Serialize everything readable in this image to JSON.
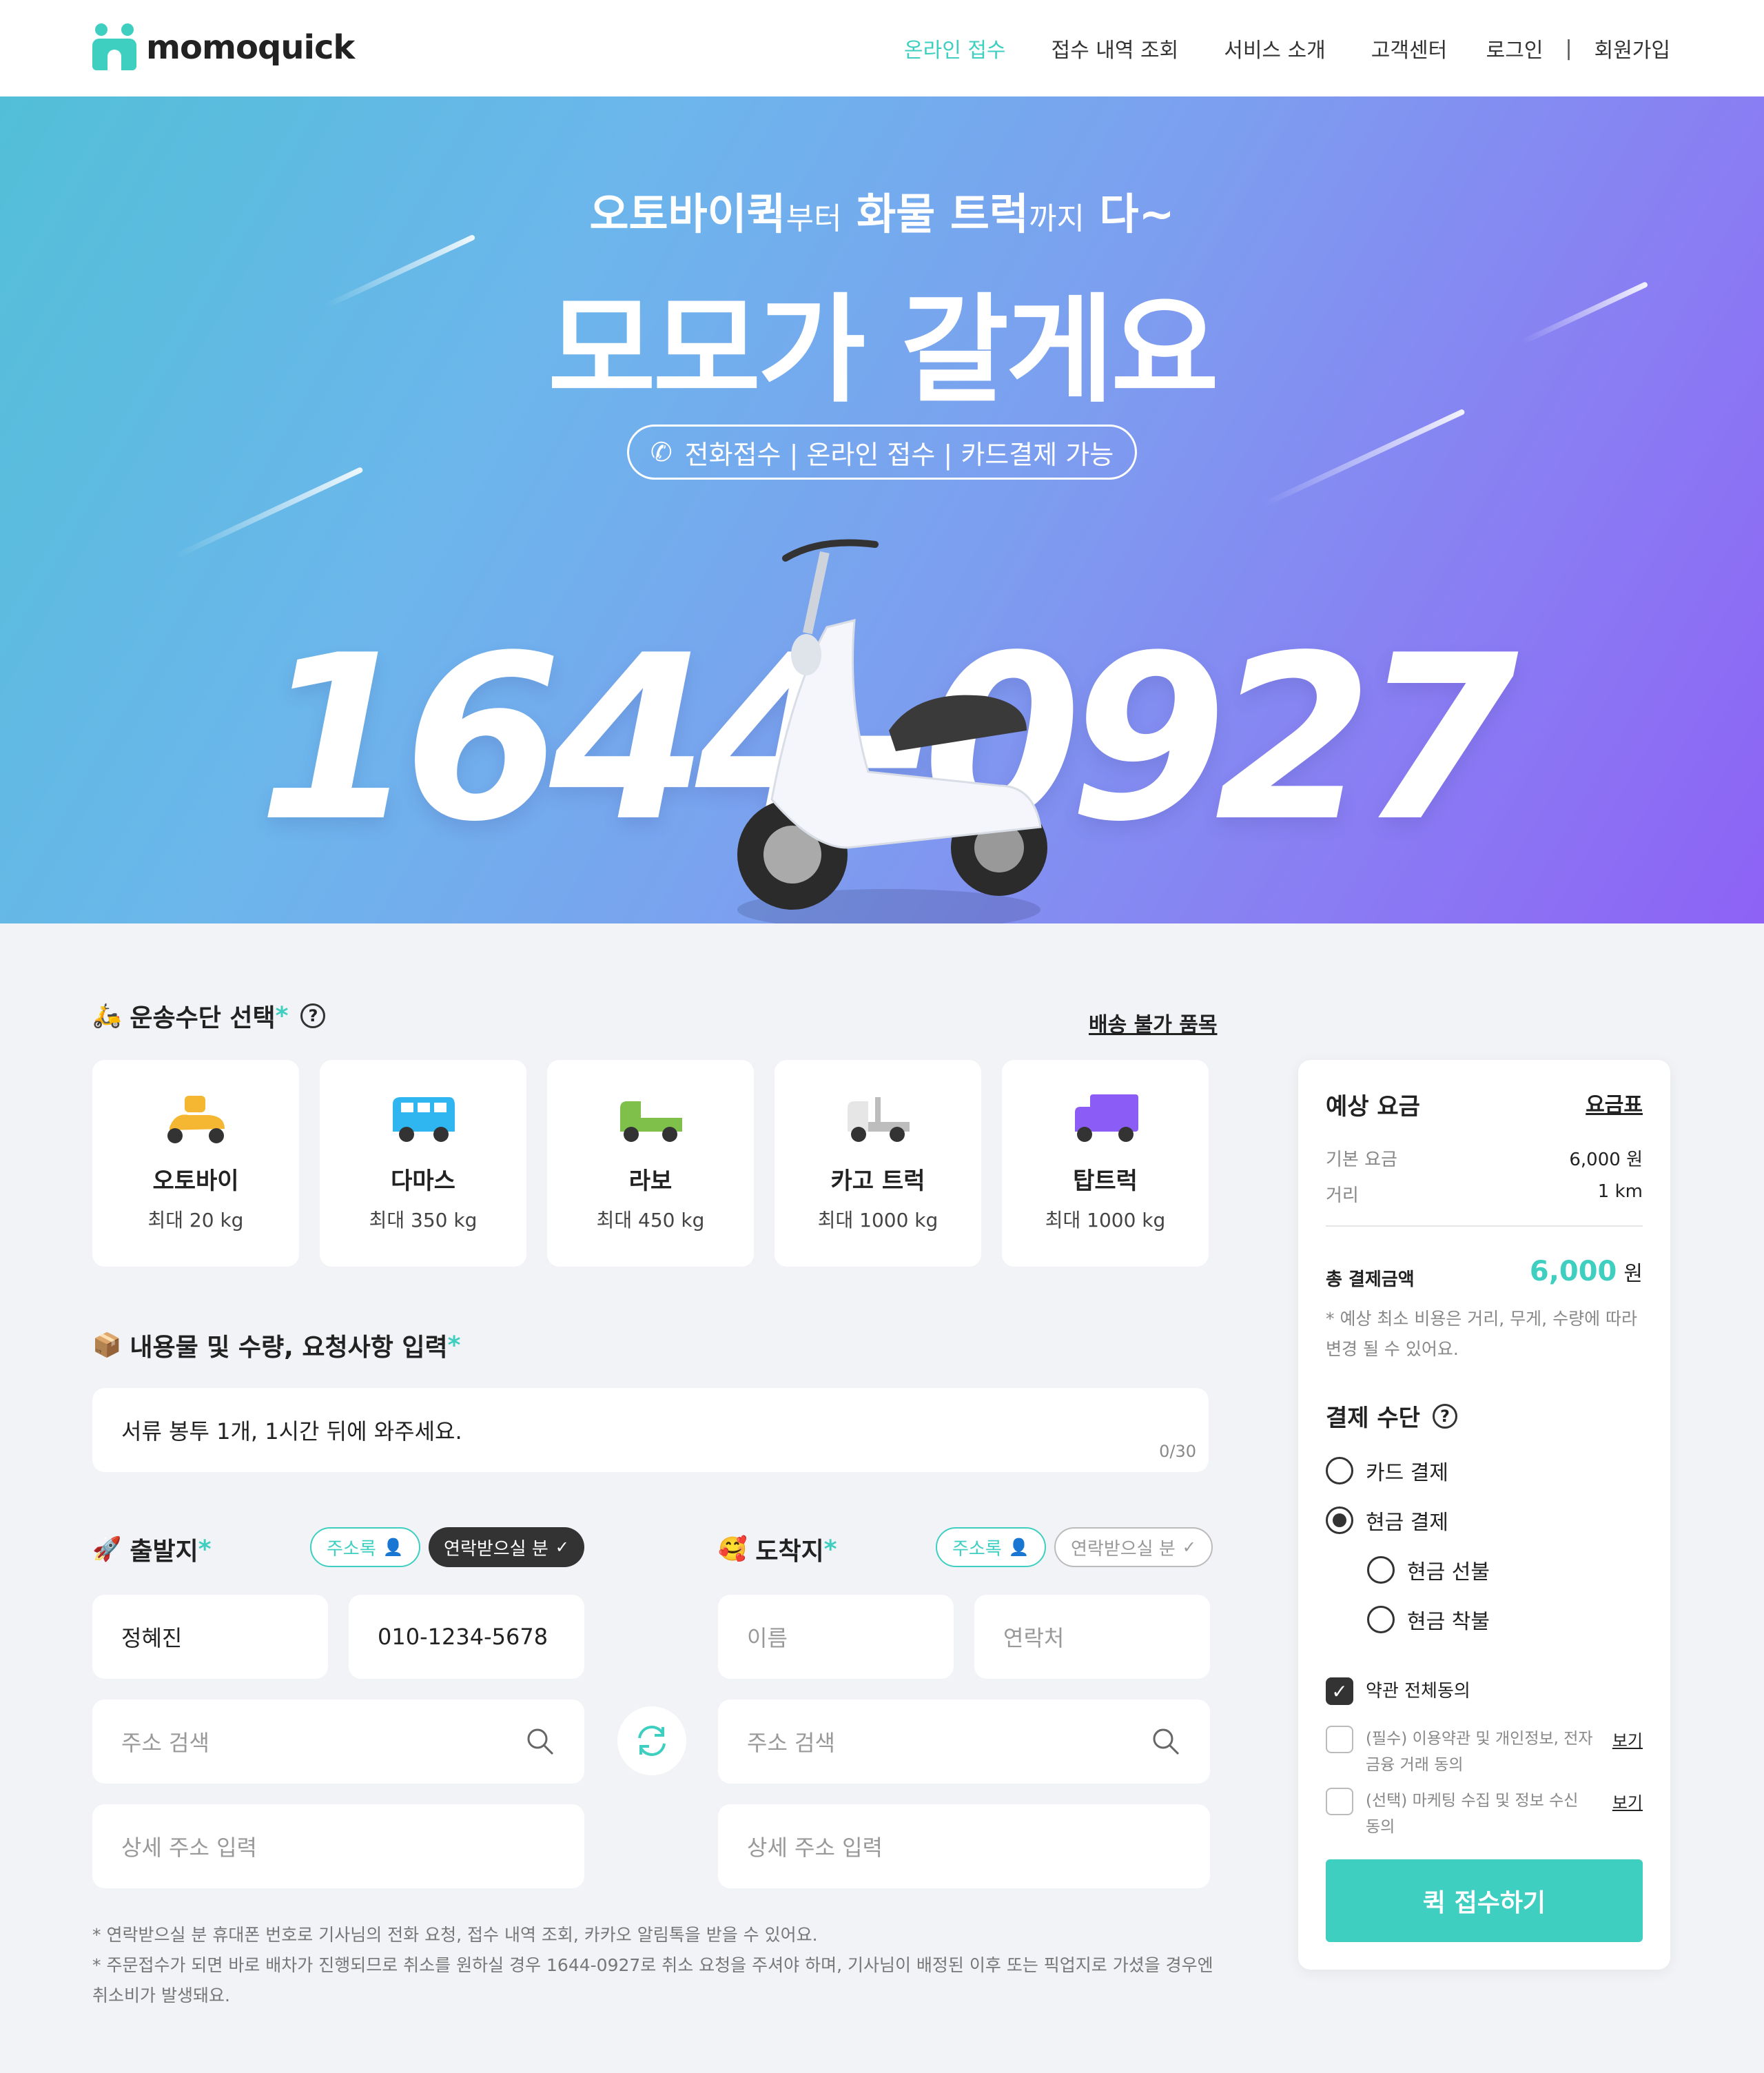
{
  "header": {
    "logo_text": "momoquick",
    "nav": [
      "온라인 접수",
      "접수 내역 조회",
      "서비스 소개",
      "고객센터"
    ],
    "login": "로그인",
    "signup": "회원가입"
  },
  "hero": {
    "sub_1": "오토바이퀵",
    "sub_2": "부터",
    "sub_3": "화물 트럭",
    "sub_4": "까지",
    "sub_5": "다~",
    "title": "모모가 갈게요",
    "pill": "전화접수 | 온라인 접수 | 카드결제 가능",
    "phone_number": "1644-0927"
  },
  "vehicle_section": {
    "title": "운송수단 선택",
    "link": "배송 불가 품목",
    "vehicles": [
      {
        "name": "오토바이",
        "cap": "최대 20 kg",
        "color": "#f5b731"
      },
      {
        "name": "다마스",
        "cap": "최대 350 kg",
        "color": "#2fb6f0"
      },
      {
        "name": "라보",
        "cap": "최대 450 kg",
        "color": "#7ec04a"
      },
      {
        "name": "카고 트럭",
        "cap": "최대 1000 kg",
        "color": "#cfcfcf"
      },
      {
        "name": "탑트럭",
        "cap": "최대 1000 kg",
        "color": "#8b5cf6"
      }
    ]
  },
  "contents_section": {
    "title": "내용물 및 수량, 요청사항 입력",
    "value": "서류 봉투 1개, 1시간 뒤에 와주세요.",
    "counter": "0/30"
  },
  "origin": {
    "title": "출발지",
    "chip_address": "주소록",
    "chip_contact": "연락받으실 분",
    "name": "정혜진",
    "phone": "010-1234-5678",
    "address_placeholder": "주소 검색",
    "detail_placeholder": "상세 주소 입력"
  },
  "destination": {
    "title": "도착지",
    "chip_address": "주소록",
    "chip_contact": "연락받으실 분",
    "name_placeholder": "이름",
    "phone_placeholder": "연락처",
    "address_placeholder": "주소 검색",
    "detail_placeholder": "상세 주소 입력"
  },
  "notes": [
    "* 연락받으실 분 휴대폰 번호로 기사님의 전화 요청, 접수 내역 조회, 카카오 알림톡을 받을 수 있어요.",
    "* 주문접수가 되면 바로 배차가 진행되므로 취소를 원하실 경우 1644-0927로 취소 요청을 주셔야 하며, 기사님이 배정된 이후 또는 픽업지로 가셨을 경우엔 취소비가 발생돼요."
  ],
  "panel": {
    "title": "예상 요금",
    "link": "요금표",
    "base_label": "기본 요금",
    "base_value": "6,000 원",
    "distance_label": "거리",
    "distance_value": "1 km",
    "total_label": "총 결제금액",
    "total_value": "6,000",
    "total_unit": "원",
    "note": "* 예상 최소 비용은 거리, 무게, 수량에 따라 변경 될 수 있어요.",
    "pay_title": "결제 수단",
    "pay_card": "카드 결제",
    "pay_cash": "현금 결제",
    "cash_pre": "현금 선불",
    "cash_post": "현금 착불",
    "agree_all": "약관 전체동의",
    "agree_required": "(필수) 이용약관 및 개인정보, 전자금융 거래 동의",
    "agree_optional": "(선택) 마케팅 수집 및 정보 수신 동의",
    "view": "보기",
    "submit": "퀵 접수하기"
  },
  "colors": {
    "accent": "#3ecfc0",
    "dark": "#333333"
  }
}
